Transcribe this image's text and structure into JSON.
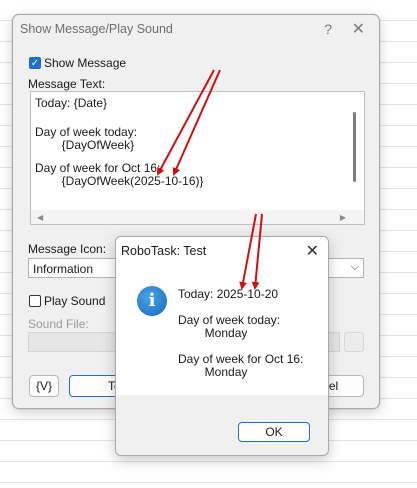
{
  "main_dialog": {
    "title": "Show Message/Play Sound",
    "help_glyph": "?",
    "close_glyph": "✕",
    "show_message_label": "Show Message",
    "show_message_checked": true,
    "message_text_label": "Message Text:",
    "message_lines": [
      "Today: {Date}",
      "Day of week today:",
      "        {DayOfWeek}",
      "Day of week for Oct 16:",
      "        {DayOfWeek(2025-10-16)}"
    ],
    "message_icon_label": "Message Icon:",
    "message_icon_value": "Information",
    "play_sound_label": "Play Sound",
    "play_sound_checked": false,
    "sound_file_label": "Sound File:",
    "variables_button": "{V}",
    "test_button": "Test",
    "cancel_button": "Cancel"
  },
  "test_dialog": {
    "title": "RoboTask: Test",
    "close_glyph": "✕",
    "icon_glyph": "i",
    "lines": [
      "Today: 2025-10-20",
      "Day of week today:",
      "        Monday",
      "Day of week for Oct 16:",
      "        Monday"
    ],
    "ok_button": "OK"
  },
  "colors": {
    "accent": "#1f6fd1",
    "arrow": "#cc1111",
    "dialog_bg": "#f0f0f0"
  },
  "icons": {
    "checkbox_check": "✓",
    "chevron_down": "⌵",
    "scroll_left": "◀",
    "scroll_right": "▶"
  }
}
